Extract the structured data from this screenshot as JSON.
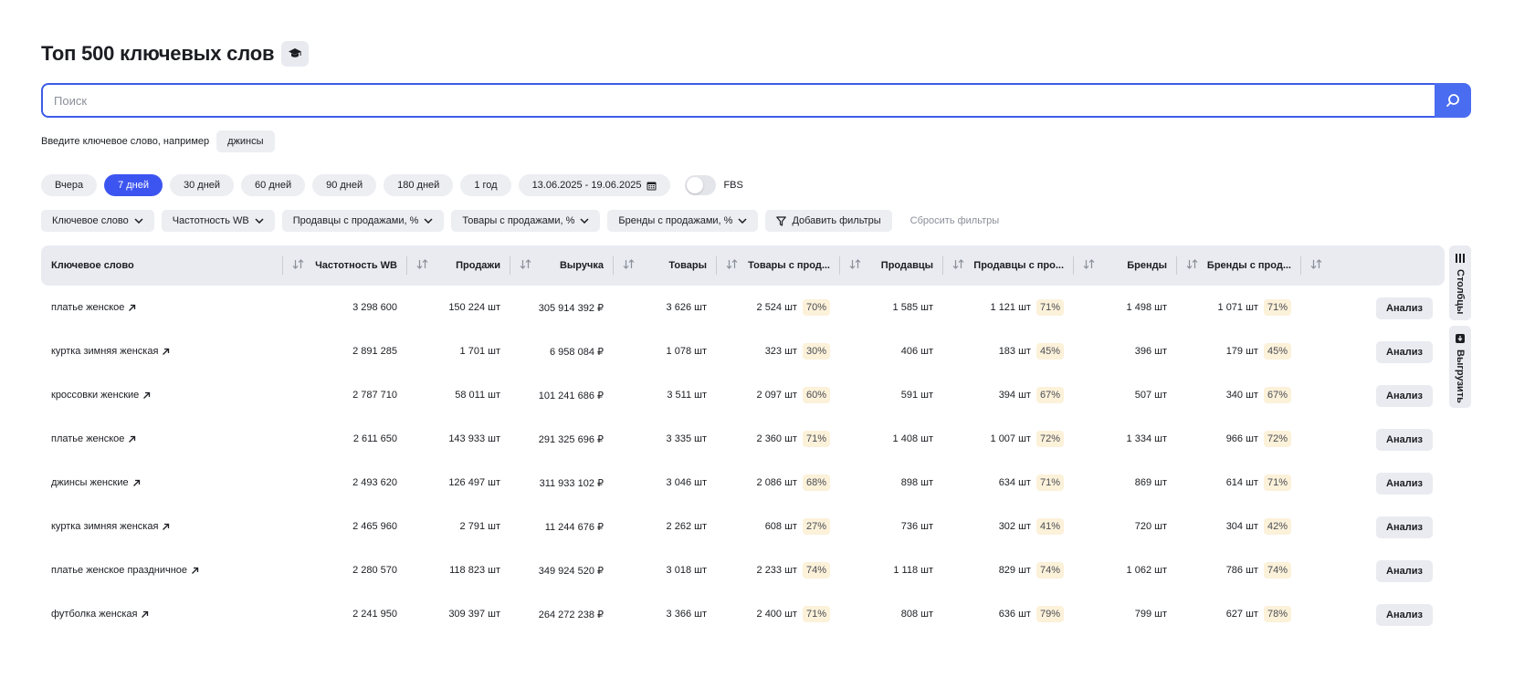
{
  "header": {
    "title": "Топ 500 ключевых слов",
    "help_icon": "graduation-cap-icon"
  },
  "search": {
    "placeholder": "Поиск",
    "value": "",
    "icon": "search-icon"
  },
  "hint": {
    "text": "Введите ключевое слово, например",
    "example": "джинсы"
  },
  "periods": [
    {
      "label": "Вчера",
      "active": false
    },
    {
      "label": "7 дней",
      "active": true
    },
    {
      "label": "30 дней",
      "active": false
    },
    {
      "label": "60 дней",
      "active": false
    },
    {
      "label": "90 дней",
      "active": false
    },
    {
      "label": "180 дней",
      "active": false
    },
    {
      "label": "1 год",
      "active": false
    }
  ],
  "date_range": "13.06.2025 - 19.06.2025",
  "fbs": {
    "label": "FBS",
    "enabled": false
  },
  "filters": [
    "Ключевое слово",
    "Частотность WB",
    "Продавцы с продажами, %",
    "Товары с продажами, %",
    "Бренды с продажами, %"
  ],
  "add_filters_label": "Добавить фильтры",
  "reset_filters_label": "Сбросить фильтры",
  "columns": [
    "Ключевое слово",
    "Частотность WB",
    "Продажи",
    "Выручка",
    "Товары",
    "Товары с прод...",
    "Продавцы",
    "Продавцы с про...",
    "Бренды",
    "Бренды с прод..."
  ],
  "rows": [
    {
      "keyword": "платье женское",
      "freq": "3 298 600",
      "sales": "150 224 шт",
      "revenue": "305 914 392 ₽",
      "goods": "3 626 шт",
      "goods_sold": "2 524 шт",
      "goods_pct": "70%",
      "sellers": "1 585 шт",
      "sellers_sold": "1 121 шт",
      "sellers_pct": "71%",
      "brands": "1 498 шт",
      "brands_sold": "1 071 шт",
      "brands_pct": "71%"
    },
    {
      "keyword": "куртка зимняя женская",
      "freq": "2 891 285",
      "sales": "1 701 шт",
      "revenue": "6 958 084 ₽",
      "goods": "1 078 шт",
      "goods_sold": "323 шт",
      "goods_pct": "30%",
      "sellers": "406 шт",
      "sellers_sold": "183 шт",
      "sellers_pct": "45%",
      "brands": "396 шт",
      "brands_sold": "179 шт",
      "brands_pct": "45%"
    },
    {
      "keyword": "кроссовки женские",
      "freq": "2 787 710",
      "sales": "58 011 шт",
      "revenue": "101 241 686 ₽",
      "goods": "3 511 шт",
      "goods_sold": "2 097 шт",
      "goods_pct": "60%",
      "sellers": "591 шт",
      "sellers_sold": "394 шт",
      "sellers_pct": "67%",
      "brands": "507 шт",
      "brands_sold": "340 шт",
      "brands_pct": "67%"
    },
    {
      "keyword": "платье женское",
      "freq": "2 611 650",
      "sales": "143 933 шт",
      "revenue": "291 325 696 ₽",
      "goods": "3 335 шт",
      "goods_sold": "2 360 шт",
      "goods_pct": "71%",
      "sellers": "1 408 шт",
      "sellers_sold": "1 007 шт",
      "sellers_pct": "72%",
      "brands": "1 334 шт",
      "brands_sold": "966 шт",
      "brands_pct": "72%"
    },
    {
      "keyword": "джинсы женские",
      "freq": "2 493 620",
      "sales": "126 497 шт",
      "revenue": "311 933 102 ₽",
      "goods": "3 046 шт",
      "goods_sold": "2 086 шт",
      "goods_pct": "68%",
      "sellers": "898 шт",
      "sellers_sold": "634 шт",
      "sellers_pct": "71%",
      "brands": "869 шт",
      "brands_sold": "614 шт",
      "brands_pct": "71%"
    },
    {
      "keyword": "куртка зимняя женская",
      "freq": "2 465 960",
      "sales": "2 791 шт",
      "revenue": "11 244 676 ₽",
      "goods": "2 262 шт",
      "goods_sold": "608 шт",
      "goods_pct": "27%",
      "sellers": "736 шт",
      "sellers_sold": "302 шт",
      "sellers_pct": "41%",
      "brands": "720 шт",
      "brands_sold": "304 шт",
      "brands_pct": "42%"
    },
    {
      "keyword": "платье женское праздничное",
      "freq": "2 280 570",
      "sales": "118 823 шт",
      "revenue": "349 924 520 ₽",
      "goods": "3 018 шт",
      "goods_sold": "2 233 шт",
      "goods_pct": "74%",
      "sellers": "1 118 шт",
      "sellers_sold": "829 шт",
      "sellers_pct": "74%",
      "brands": "1 062 шт",
      "brands_sold": "786 шт",
      "brands_pct": "74%"
    },
    {
      "keyword": "футболка женская",
      "freq": "2 241 950",
      "sales": "309 397 шт",
      "revenue": "264 272 238 ₽",
      "goods": "3 366 шт",
      "goods_sold": "2 400 шт",
      "goods_pct": "71%",
      "sellers": "808 шт",
      "sellers_sold": "636 шт",
      "sellers_pct": "79%",
      "brands": "799 шт",
      "brands_sold": "627 шт",
      "brands_pct": "78%"
    }
  ],
  "row_action_label": "Анализ",
  "side_panel": {
    "columns_label": "Столбцы",
    "export_label": "Выгрузить"
  },
  "colors": {
    "accent": "#3d55f0",
    "search_border": "#3d5ce8",
    "badge_bg": "#fcf1d9",
    "header_bg": "#e9ebf0"
  }
}
